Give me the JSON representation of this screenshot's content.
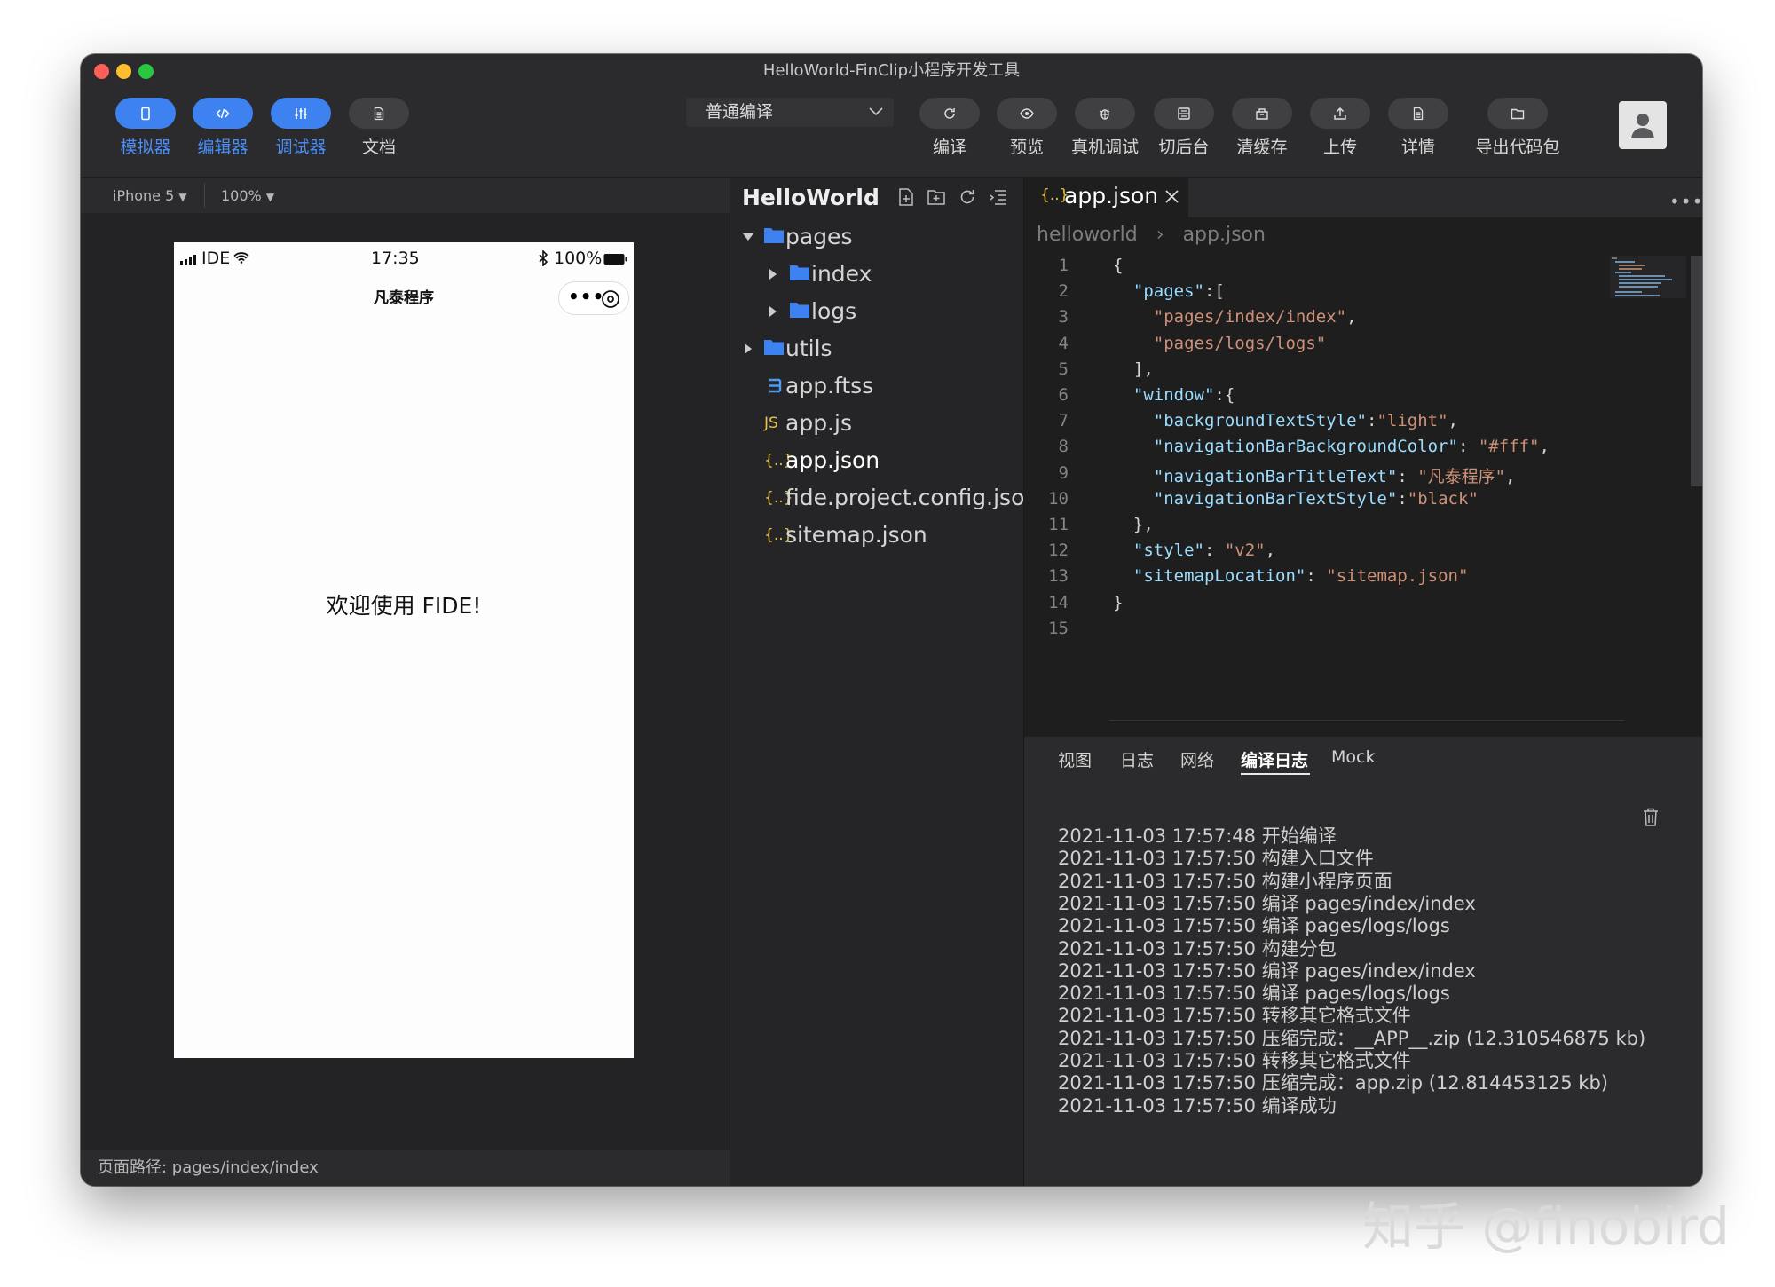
{
  "window": {
    "title": "HelloWorld-FinClip小程序开发工具"
  },
  "toolbar": {
    "left_buttons": [
      {
        "label": "模拟器",
        "icon": "phone-icon",
        "active": true
      },
      {
        "label": "编辑器",
        "icon": "code-icon",
        "active": true
      },
      {
        "label": "调试器",
        "icon": "sliders-icon",
        "active": true
      },
      {
        "label": "文档",
        "icon": "document-icon",
        "active": false
      }
    ],
    "compile_mode": "普通编译",
    "right_buttons": [
      {
        "label": "编译",
        "icon": "refresh-icon"
      },
      {
        "label": "预览",
        "icon": "eye-icon"
      },
      {
        "label": "真机调试",
        "icon": "bug-icon"
      },
      {
        "label": "切后台",
        "icon": "background-icon"
      },
      {
        "label": "清缓存",
        "icon": "clear-cache-icon"
      },
      {
        "label": "上传",
        "icon": "upload-icon"
      },
      {
        "label": "详情",
        "icon": "details-icon"
      },
      {
        "label": "导出代码包",
        "icon": "folder-export-icon"
      }
    ]
  },
  "simulator": {
    "device": "iPhone 5",
    "zoom": "100%",
    "status": {
      "carrier": "IDE",
      "time": "17:35",
      "battery": "100%"
    },
    "nav_title": "凡泰程序",
    "welcome_text": "欢迎使用 FIDE!",
    "footer_path": "页面路径: pages/index/index"
  },
  "explorer": {
    "title": "HelloWorld",
    "tree": [
      {
        "name": "pages",
        "type": "folder",
        "expanded": true,
        "level": 0
      },
      {
        "name": "index",
        "type": "folder",
        "expanded": false,
        "level": 1
      },
      {
        "name": "logs",
        "type": "folder",
        "expanded": false,
        "level": 1
      },
      {
        "name": "utils",
        "type": "folder",
        "expanded": false,
        "level": 0
      },
      {
        "name": "app.ftss",
        "type": "css",
        "level": 0
      },
      {
        "name": "app.js",
        "type": "js",
        "level": 0
      },
      {
        "name": "app.json",
        "type": "json",
        "level": 0,
        "selected": true
      },
      {
        "name": "fide.project.config.json",
        "type": "json",
        "level": 0
      },
      {
        "name": "sitemap.json",
        "type": "json",
        "level": 0
      }
    ],
    "badges": {
      "js": "JS",
      "json": "{..}"
    }
  },
  "editor": {
    "tab": "app.json",
    "breadcrumb": [
      "helloworld",
      "app.json"
    ],
    "line_numbers": [
      "1",
      "2",
      "3",
      "4",
      "5",
      "6",
      "7",
      "8",
      "9",
      "10",
      "11",
      "12",
      "13",
      "14",
      "15"
    ],
    "code_lines": [
      "{",
      "  \"pages\":[",
      "    \"pages/index/index\",",
      "    \"pages/logs/logs\"",
      "  ],",
      "  \"window\":{",
      "    \"backgroundTextStyle\":\"light\",",
      "    \"navigationBarBackgroundColor\": \"#fff\",",
      "    \"navigationBarTitleText\": \"凡泰程序\",",
      "    \"navigationBarTextStyle\":\"black\"",
      "  },",
      "  \"style\": \"v2\",",
      "  \"sitemapLocation\": \"sitemap.json\"",
      "}",
      ""
    ]
  },
  "console": {
    "tabs": [
      "视图",
      "日志",
      "网络",
      "编译日志",
      "Mock"
    ],
    "active_tab": "编译日志",
    "logs": [
      "2021-11-03 17:57:48 开始编译",
      "2021-11-03 17:57:50 构建入口文件",
      "2021-11-03 17:57:50 构建小程序页面",
      "2021-11-03 17:57:50 编译 pages/index/index",
      "2021-11-03 17:57:50 编译 pages/logs/logs",
      "2021-11-03 17:57:50 构建分包",
      "2021-11-03 17:57:50 编译 pages/index/index",
      "2021-11-03 17:57:50 编译 pages/logs/logs",
      "2021-11-03 17:57:50 转移其它格式文件",
      "2021-11-03 17:57:50 压缩完成：__APP__.zip (12.310546875 kb)",
      "2021-11-03 17:57:50 转移其它格式文件",
      "2021-11-03 17:57:50 压缩完成：app.zip (12.814453125 kb)",
      "2021-11-03 17:57:50 编译成功"
    ]
  },
  "watermark": "知乎 @finobird",
  "colors": {
    "accent": "#3d82f0",
    "window_bg": "#2b2b2d",
    "editor_bg": "#1e1e1f",
    "json_key": "#9cdcfe",
    "json_string": "#ce9178",
    "folder": "#3d82f0",
    "traffic_close": "#fe5f57",
    "traffic_min": "#febc2e",
    "traffic_max": "#28c840"
  }
}
